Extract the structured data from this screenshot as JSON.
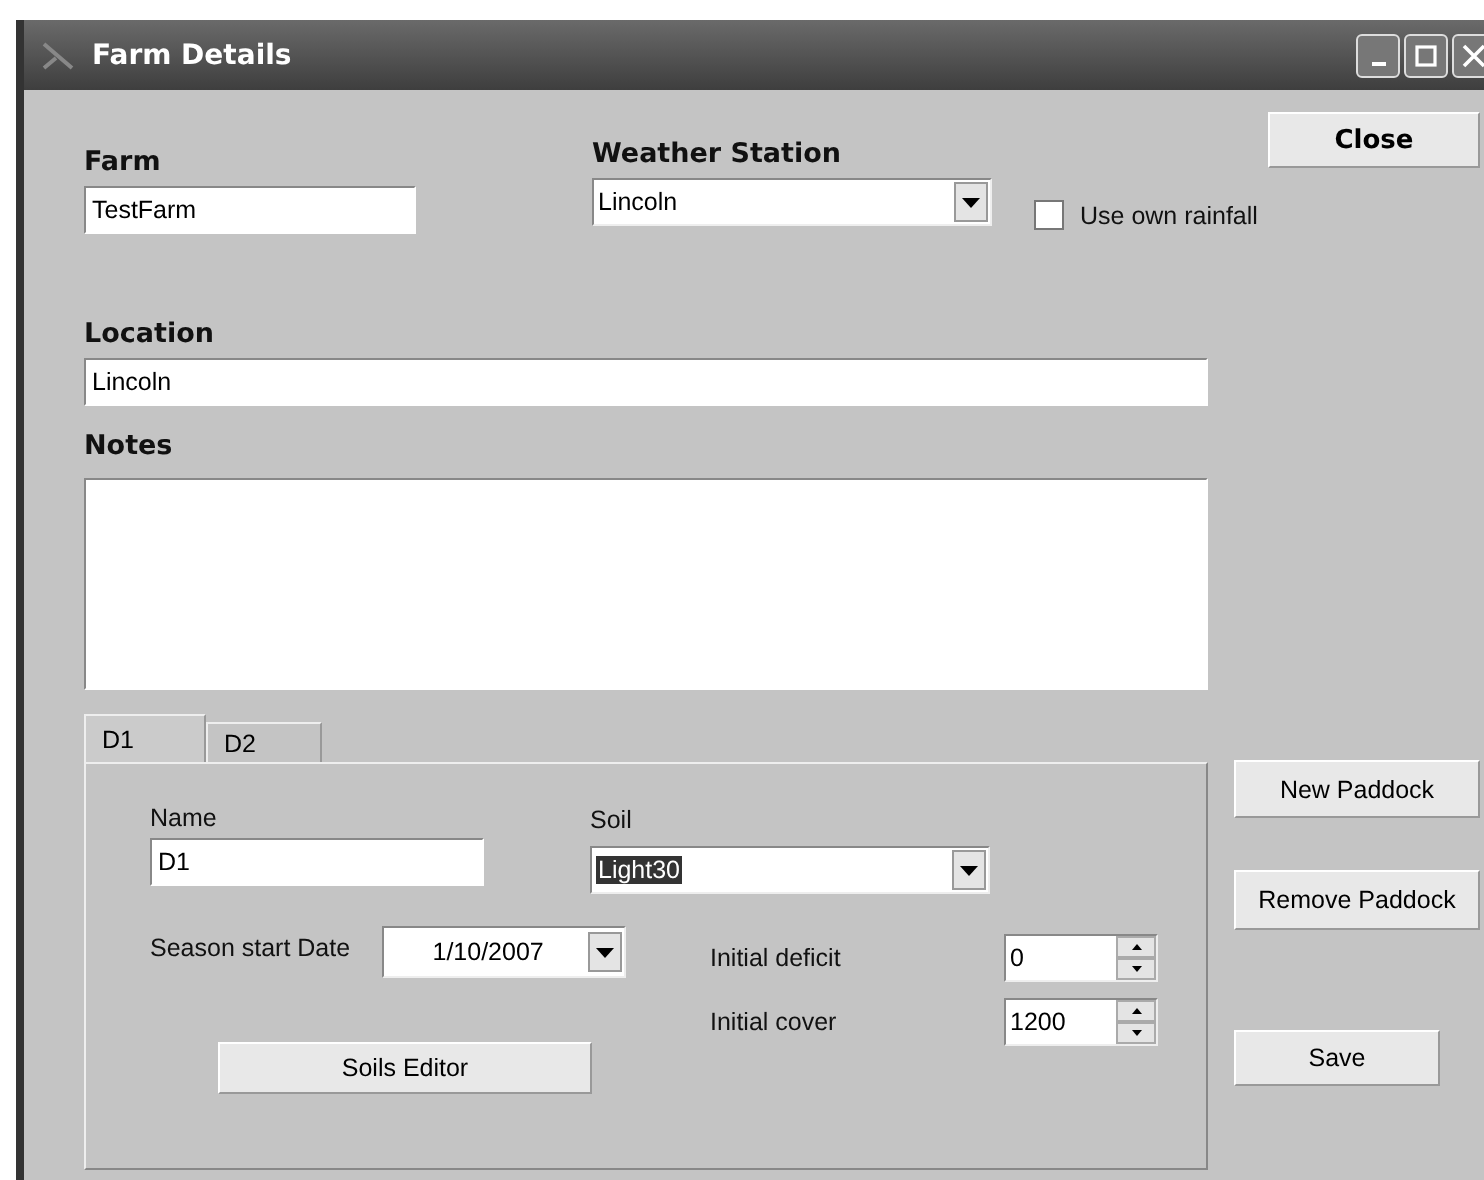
{
  "window": {
    "title": "Farm Details"
  },
  "farm": {
    "label": "Farm",
    "value": "TestFarm"
  },
  "weather_station": {
    "label": "Weather Station",
    "value": "Lincoln"
  },
  "use_own_rainfall": {
    "label": "Use own rainfall",
    "checked": false
  },
  "close_button": "Close",
  "location": {
    "label": "Location",
    "value": "Lincoln"
  },
  "notes": {
    "label": "Notes"
  },
  "tabs": [
    {
      "label": "D1",
      "selected": true
    },
    {
      "label": "D2",
      "selected": false
    }
  ],
  "paddock": {
    "name": {
      "label": "Name",
      "value": "D1"
    },
    "soil": {
      "label": "Soil",
      "value": "Light30",
      "highlighted": true
    },
    "season_start_date": {
      "label": "Season start Date",
      "value": "1/10/2007"
    },
    "initial_deficit": {
      "label": "Initial deficit",
      "value": "0"
    },
    "initial_cover": {
      "label": "Initial cover",
      "value": "1200"
    },
    "soils_editor_button": "Soils Editor"
  },
  "side_buttons": [
    "New Paddock",
    "Remove Paddock",
    "Save"
  ]
}
